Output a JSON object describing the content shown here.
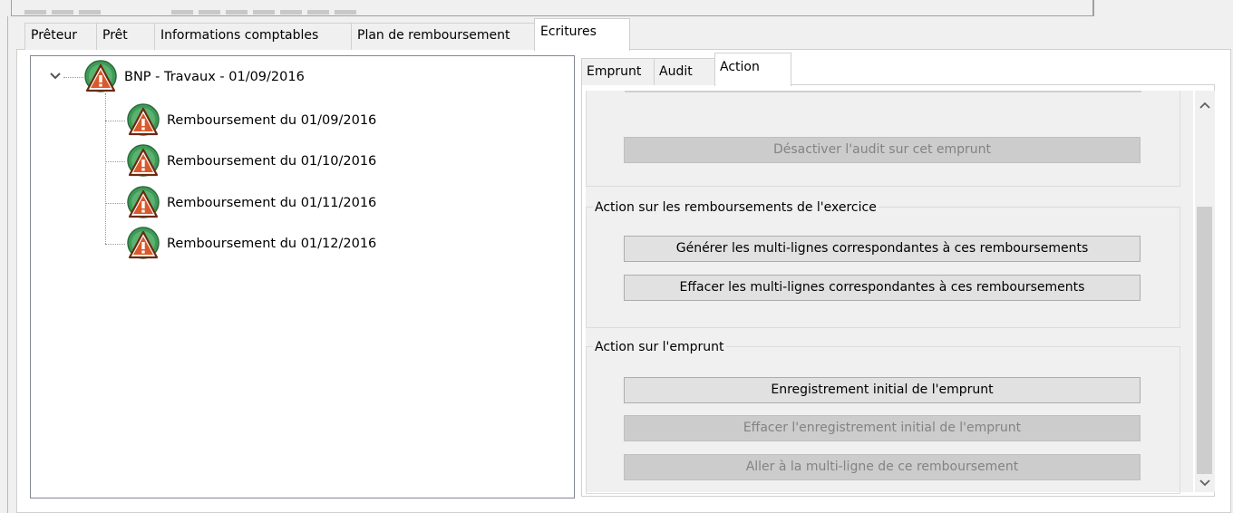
{
  "main_tabs": [
    {
      "label": "Prêteur"
    },
    {
      "label": "Prêt"
    },
    {
      "label": "Informations comptables"
    },
    {
      "label": "Plan de remboursement"
    },
    {
      "label": "Ecritures",
      "selected": true
    }
  ],
  "tree": {
    "root": {
      "label": "BNP - Travaux - 01/09/2016",
      "icon": "warning-icon",
      "expanded": true
    },
    "children": [
      {
        "label": "Remboursement du 01/09/2016",
        "icon": "warning-icon"
      },
      {
        "label": "Remboursement du 01/10/2016",
        "icon": "warning-icon"
      },
      {
        "label": "Remboursement du 01/11/2016",
        "icon": "warning-icon"
      },
      {
        "label": "Remboursement du 01/12/2016",
        "icon": "warning-icon"
      }
    ]
  },
  "sub_tabs": [
    {
      "label": "Emprunt"
    },
    {
      "label": "Audit"
    },
    {
      "label": "Action",
      "selected": true
    }
  ],
  "audit_group": {
    "button": {
      "label": "Désactiver l'audit sur cet emprunt",
      "enabled": false
    }
  },
  "remboursements_group": {
    "title": "Action sur les remboursements de l'exercice",
    "buttons": [
      {
        "label": "Générer les multi-lignes correspondantes à ces remboursements",
        "enabled": true
      },
      {
        "label": "Effacer les multi-lignes correspondantes à ces remboursements",
        "enabled": true
      }
    ]
  },
  "emprunt_group": {
    "title": "Action sur l'emprunt",
    "buttons": [
      {
        "label": "Enregistrement initial de l'emprunt",
        "enabled": true
      },
      {
        "label": "Effacer l'enregistrement initial de l'emprunt",
        "enabled": false
      },
      {
        "label": "Aller à la multi-ligne de ce remboursement",
        "enabled": false
      }
    ]
  },
  "colors": {
    "icon_green": "#3f9a57",
    "icon_warning_fill": "#d9592b",
    "panel_bg": "#f0f0f0",
    "disabled_text": "#838383"
  }
}
